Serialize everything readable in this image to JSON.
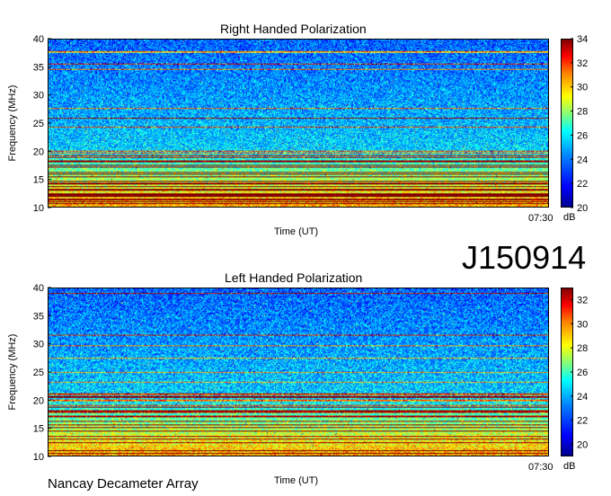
{
  "page": {
    "id_label": "J150914",
    "footer": "Nancay Decameter Array"
  },
  "chart_data": [
    {
      "type": "heatmap",
      "title": "Right Handed Polarization",
      "ylabel": "Frequency (MHz)",
      "xlabel": "Time (UT)",
      "ylim": [
        10,
        40
      ],
      "yticks": [
        "10",
        "15",
        "20",
        "25",
        "30",
        "35",
        "40"
      ],
      "xticks": [
        "07:30"
      ],
      "colorbar": {
        "label": "dB",
        "range": [
          20,
          34
        ],
        "ticks": [
          "20",
          "22",
          "24",
          "26",
          "28",
          "30",
          "32",
          "34"
        ]
      },
      "colors": {
        "low": "#0000a0",
        "background": "#1e5cf0",
        "high": "#a00000"
      }
    },
    {
      "type": "heatmap",
      "title": "Left Handed Polarization",
      "ylabel": "Frequency (MHz)",
      "xlabel": "Time (UT)",
      "ylim": [
        10,
        40
      ],
      "yticks": [
        "10",
        "15",
        "20",
        "25",
        "30",
        "35",
        "40"
      ],
      "xticks": [
        "07:30"
      ],
      "colorbar": {
        "label": "dB",
        "range": [
          19,
          33
        ],
        "ticks": [
          "20",
          "22",
          "24",
          "26",
          "28",
          "30",
          "32"
        ]
      },
      "colors": {
        "low": "#0000a0",
        "background": "#1e5cf0",
        "high": "#a00000"
      }
    }
  ]
}
